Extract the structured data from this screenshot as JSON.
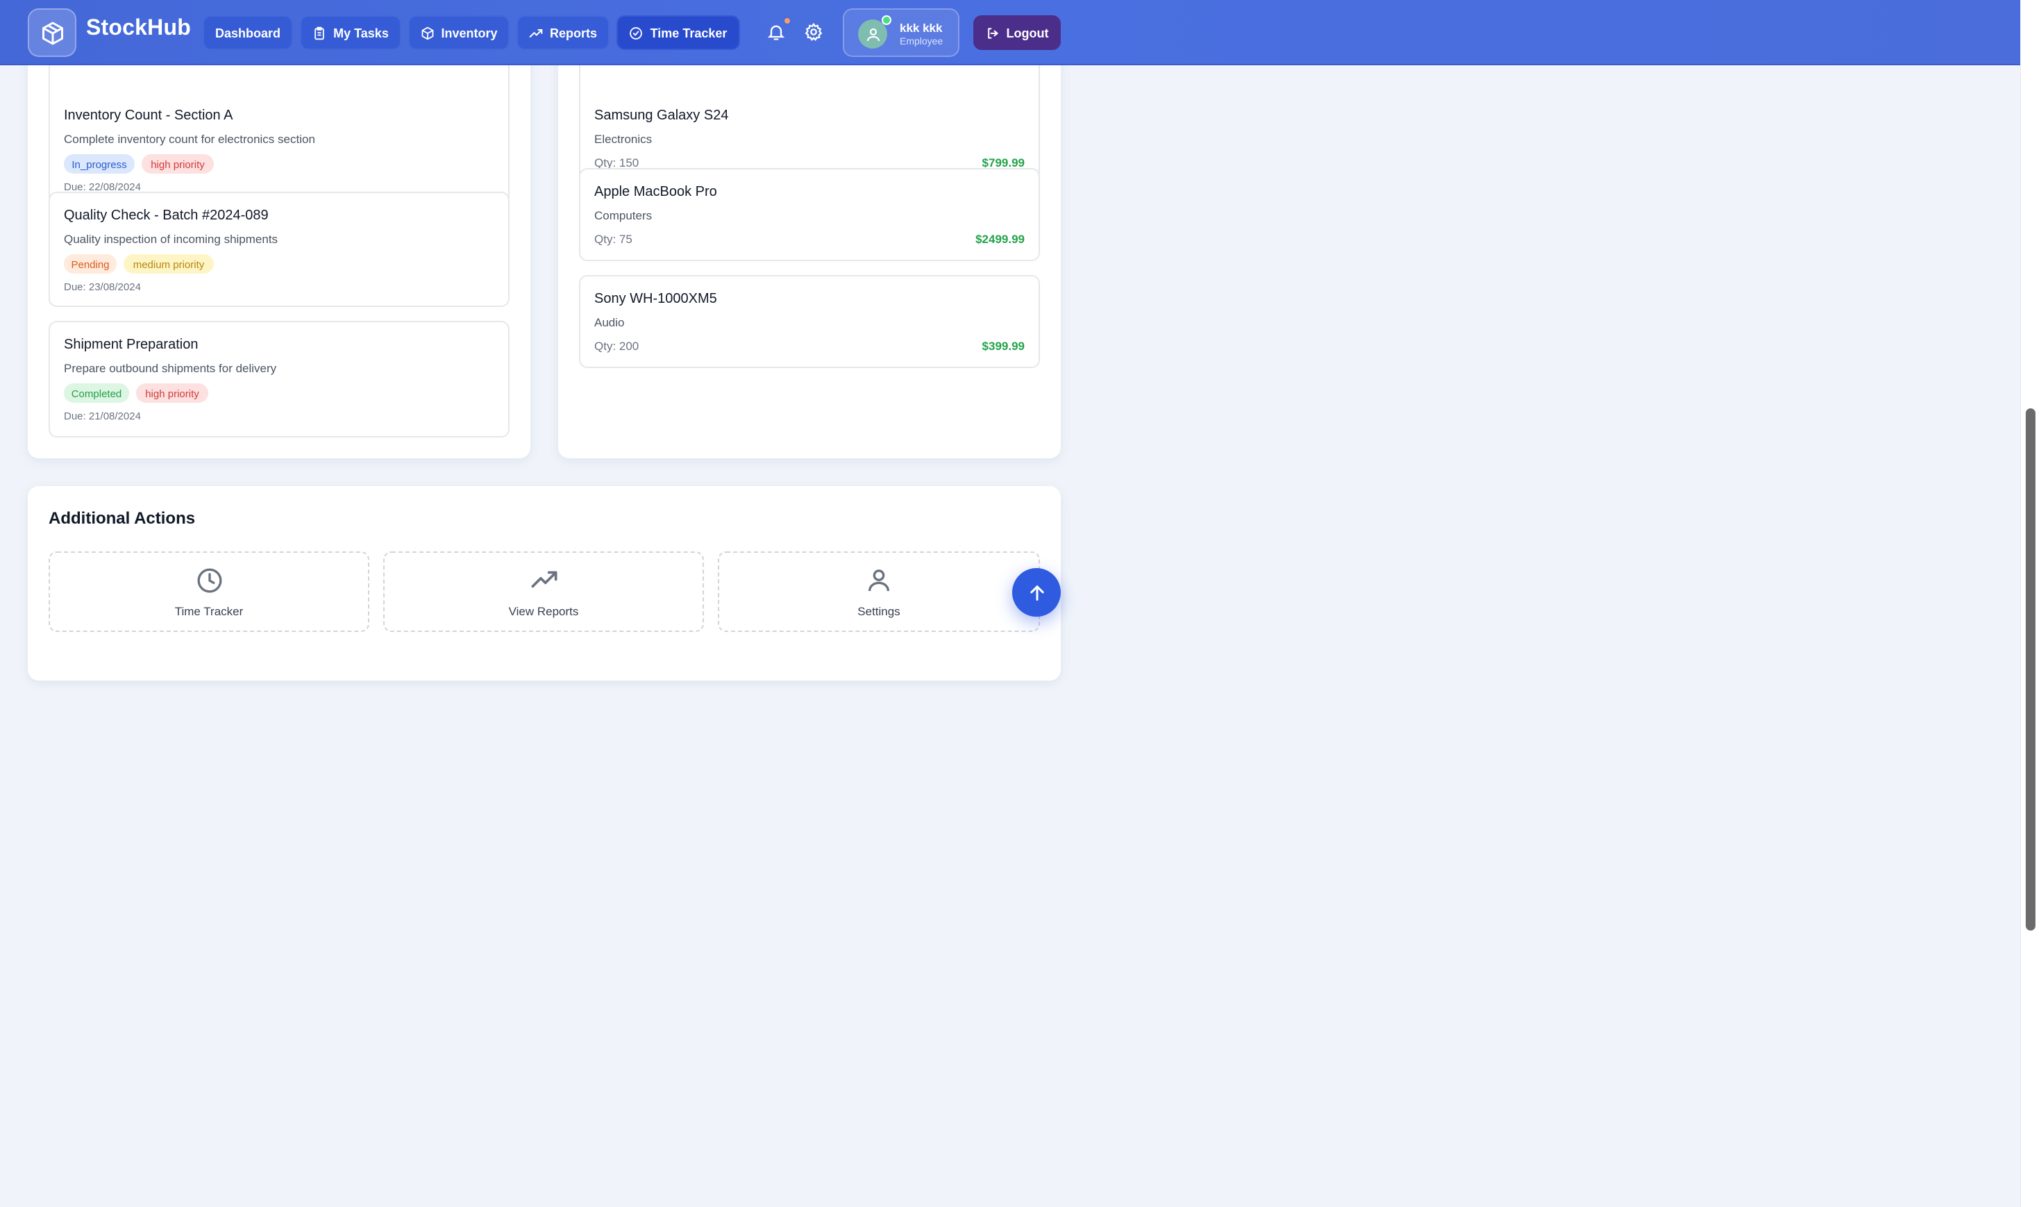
{
  "app": {
    "brand": "StockHub"
  },
  "nav": {
    "dashboard": "Dashboard",
    "my_tasks": "My Tasks",
    "inventory": "Inventory",
    "reports": "Reports",
    "time_tracker": "Time Tracker"
  },
  "user": {
    "name": "kkk kkk",
    "role": "Employee"
  },
  "logout": "Logout",
  "tasks": [
    {
      "title": "Inventory Count - Section A",
      "description": "Complete inventory count for electronics section",
      "status": "In_progress",
      "priority": "high priority",
      "due": "Due: 22/08/2024"
    },
    {
      "title": "Quality Check - Batch #2024-089",
      "description": "Quality inspection of incoming shipments",
      "status": "Pending",
      "priority": "medium priority",
      "due": "Due: 23/08/2024"
    },
    {
      "title": "Shipment Preparation",
      "description": "Prepare outbound shipments for delivery",
      "status": "Completed",
      "priority": "high priority",
      "due": "Due: 21/08/2024"
    }
  ],
  "products": [
    {
      "name": "Samsung Galaxy S24",
      "category": "Electronics",
      "qty": "Qty: 150",
      "price": "$799.99"
    },
    {
      "name": "Apple MacBook Pro",
      "category": "Computers",
      "qty": "Qty: 75",
      "price": "$2499.99"
    },
    {
      "name": "Sony WH-1000XM5",
      "category": "Audio",
      "qty": "Qty: 200",
      "price": "$399.99"
    }
  ],
  "additional_actions": {
    "title": "Additional Actions",
    "items": [
      {
        "label": "Time Tracker",
        "icon": "clock-icon"
      },
      {
        "label": "View Reports",
        "icon": "trending-up-icon"
      },
      {
        "label": "Settings",
        "icon": "user-icon"
      }
    ]
  },
  "colors": {
    "header": "#4a6ddb",
    "logout": "#4b2e8a",
    "price": "#22a34a",
    "fab": "#2f5be0"
  }
}
